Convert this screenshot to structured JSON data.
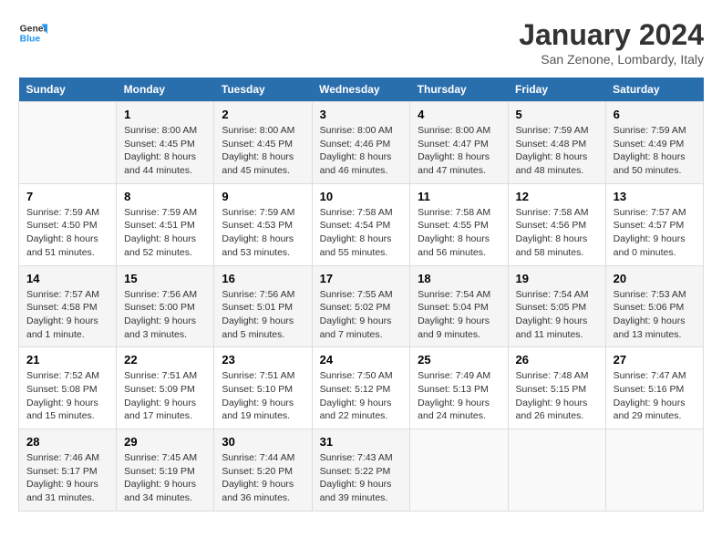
{
  "header": {
    "logo_line1": "General",
    "logo_line2": "Blue",
    "month": "January 2024",
    "location": "San Zenone, Lombardy, Italy"
  },
  "days_of_week": [
    "Sunday",
    "Monday",
    "Tuesday",
    "Wednesday",
    "Thursday",
    "Friday",
    "Saturday"
  ],
  "weeks": [
    [
      {
        "day": "",
        "content": ""
      },
      {
        "day": "1",
        "content": "Sunrise: 8:00 AM\nSunset: 4:45 PM\nDaylight: 8 hours\nand 44 minutes."
      },
      {
        "day": "2",
        "content": "Sunrise: 8:00 AM\nSunset: 4:45 PM\nDaylight: 8 hours\nand 45 minutes."
      },
      {
        "day": "3",
        "content": "Sunrise: 8:00 AM\nSunset: 4:46 PM\nDaylight: 8 hours\nand 46 minutes."
      },
      {
        "day": "4",
        "content": "Sunrise: 8:00 AM\nSunset: 4:47 PM\nDaylight: 8 hours\nand 47 minutes."
      },
      {
        "day": "5",
        "content": "Sunrise: 7:59 AM\nSunset: 4:48 PM\nDaylight: 8 hours\nand 48 minutes."
      },
      {
        "day": "6",
        "content": "Sunrise: 7:59 AM\nSunset: 4:49 PM\nDaylight: 8 hours\nand 50 minutes."
      }
    ],
    [
      {
        "day": "7",
        "content": "Sunrise: 7:59 AM\nSunset: 4:50 PM\nDaylight: 8 hours\nand 51 minutes."
      },
      {
        "day": "8",
        "content": "Sunrise: 7:59 AM\nSunset: 4:51 PM\nDaylight: 8 hours\nand 52 minutes."
      },
      {
        "day": "9",
        "content": "Sunrise: 7:59 AM\nSunset: 4:53 PM\nDaylight: 8 hours\nand 53 minutes."
      },
      {
        "day": "10",
        "content": "Sunrise: 7:58 AM\nSunset: 4:54 PM\nDaylight: 8 hours\nand 55 minutes."
      },
      {
        "day": "11",
        "content": "Sunrise: 7:58 AM\nSunset: 4:55 PM\nDaylight: 8 hours\nand 56 minutes."
      },
      {
        "day": "12",
        "content": "Sunrise: 7:58 AM\nSunset: 4:56 PM\nDaylight: 8 hours\nand 58 minutes."
      },
      {
        "day": "13",
        "content": "Sunrise: 7:57 AM\nSunset: 4:57 PM\nDaylight: 9 hours\nand 0 minutes."
      }
    ],
    [
      {
        "day": "14",
        "content": "Sunrise: 7:57 AM\nSunset: 4:58 PM\nDaylight: 9 hours\nand 1 minute."
      },
      {
        "day": "15",
        "content": "Sunrise: 7:56 AM\nSunset: 5:00 PM\nDaylight: 9 hours\nand 3 minutes."
      },
      {
        "day": "16",
        "content": "Sunrise: 7:56 AM\nSunset: 5:01 PM\nDaylight: 9 hours\nand 5 minutes."
      },
      {
        "day": "17",
        "content": "Sunrise: 7:55 AM\nSunset: 5:02 PM\nDaylight: 9 hours\nand 7 minutes."
      },
      {
        "day": "18",
        "content": "Sunrise: 7:54 AM\nSunset: 5:04 PM\nDaylight: 9 hours\nand 9 minutes."
      },
      {
        "day": "19",
        "content": "Sunrise: 7:54 AM\nSunset: 5:05 PM\nDaylight: 9 hours\nand 11 minutes."
      },
      {
        "day": "20",
        "content": "Sunrise: 7:53 AM\nSunset: 5:06 PM\nDaylight: 9 hours\nand 13 minutes."
      }
    ],
    [
      {
        "day": "21",
        "content": "Sunrise: 7:52 AM\nSunset: 5:08 PM\nDaylight: 9 hours\nand 15 minutes."
      },
      {
        "day": "22",
        "content": "Sunrise: 7:51 AM\nSunset: 5:09 PM\nDaylight: 9 hours\nand 17 minutes."
      },
      {
        "day": "23",
        "content": "Sunrise: 7:51 AM\nSunset: 5:10 PM\nDaylight: 9 hours\nand 19 minutes."
      },
      {
        "day": "24",
        "content": "Sunrise: 7:50 AM\nSunset: 5:12 PM\nDaylight: 9 hours\nand 22 minutes."
      },
      {
        "day": "25",
        "content": "Sunrise: 7:49 AM\nSunset: 5:13 PM\nDaylight: 9 hours\nand 24 minutes."
      },
      {
        "day": "26",
        "content": "Sunrise: 7:48 AM\nSunset: 5:15 PM\nDaylight: 9 hours\nand 26 minutes."
      },
      {
        "day": "27",
        "content": "Sunrise: 7:47 AM\nSunset: 5:16 PM\nDaylight: 9 hours\nand 29 minutes."
      }
    ],
    [
      {
        "day": "28",
        "content": "Sunrise: 7:46 AM\nSunset: 5:17 PM\nDaylight: 9 hours\nand 31 minutes."
      },
      {
        "day": "29",
        "content": "Sunrise: 7:45 AM\nSunset: 5:19 PM\nDaylight: 9 hours\nand 34 minutes."
      },
      {
        "day": "30",
        "content": "Sunrise: 7:44 AM\nSunset: 5:20 PM\nDaylight: 9 hours\nand 36 minutes."
      },
      {
        "day": "31",
        "content": "Sunrise: 7:43 AM\nSunset: 5:22 PM\nDaylight: 9 hours\nand 39 minutes."
      },
      {
        "day": "",
        "content": ""
      },
      {
        "day": "",
        "content": ""
      },
      {
        "day": "",
        "content": ""
      }
    ]
  ]
}
